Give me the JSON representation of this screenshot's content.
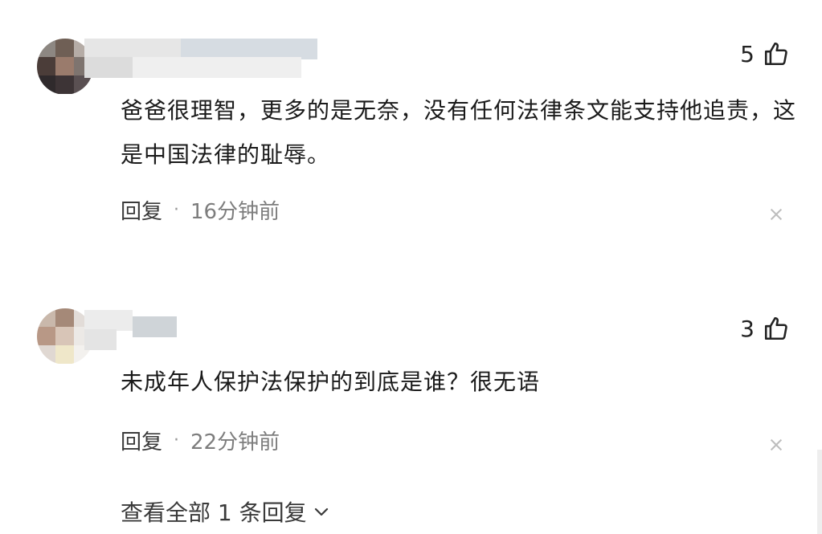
{
  "comments": [
    {
      "likes": "5",
      "text": "爸爸很理智，更多的是无奈，没有任何法律条文能支持他追责，这是中国法律的耻辱。",
      "reply_label": "回复",
      "separator": "·",
      "time": "16分钟前"
    },
    {
      "likes": "3",
      "text": "未成年人保护法保护的到底是谁？很无语",
      "reply_label": "回复",
      "separator": "·",
      "time": "22分钟前"
    }
  ],
  "view_all_replies": "查看全部 1 条回复",
  "icons": {
    "like": "thumbs-up-icon",
    "close": "close-icon",
    "expand": "chevron-down-icon"
  },
  "colors": {
    "text": "#1a1a1a",
    "meta": "#7d7d7d",
    "close": "#bdbdbd"
  }
}
